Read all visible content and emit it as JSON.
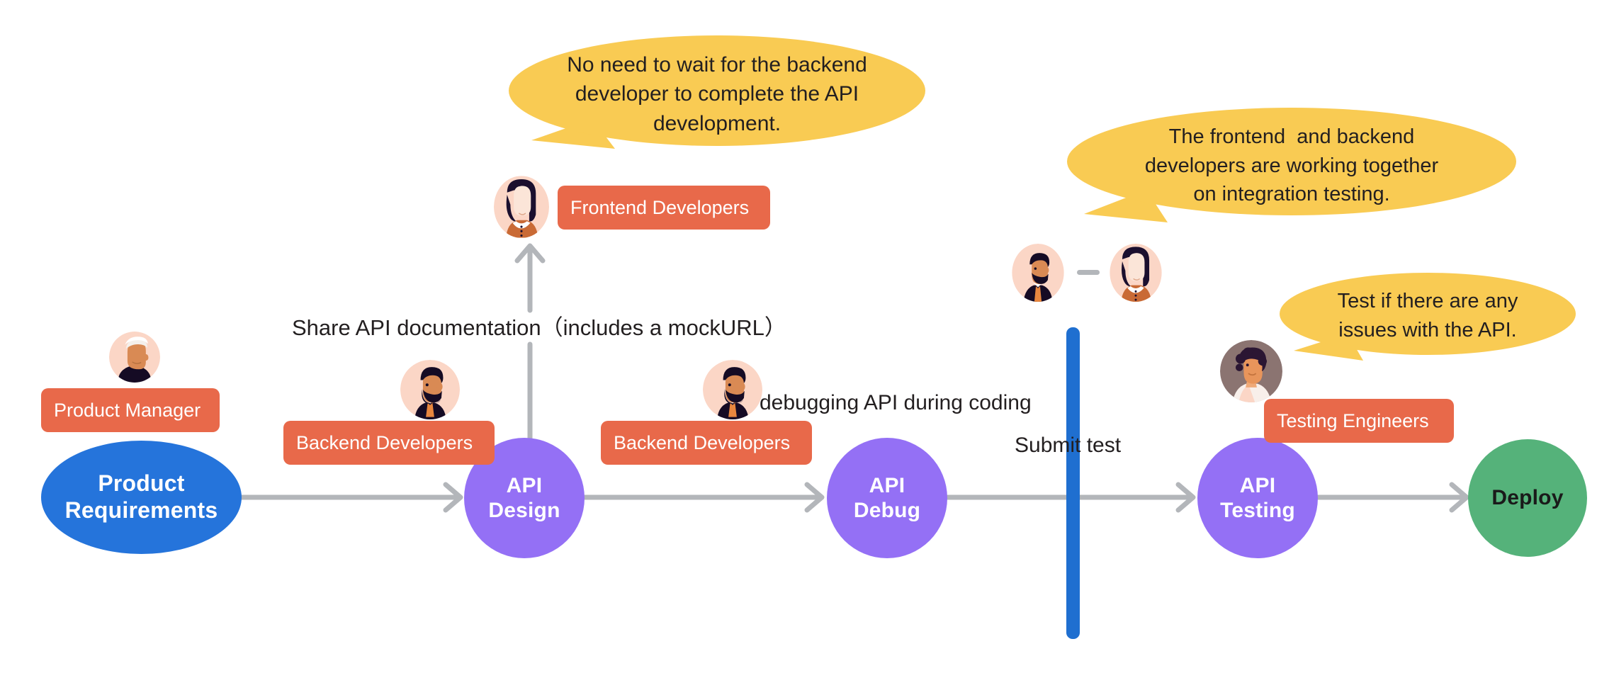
{
  "diagram": {
    "title": "API development collaboration flow",
    "colors": {
      "blue_node": "#2574DB",
      "purple_node": "#9470F5",
      "green_node": "#55B27A",
      "orange_pill": "#E8694A",
      "yellow_bubble": "#F9CB53",
      "arrow_grey": "#B3B6BA",
      "lane_blue": "#1F6FD0",
      "text_dark": "#231f20",
      "text_light": "#ffffff"
    },
    "flow_nodes": [
      {
        "id": "product-requirements",
        "label_line1": "Product",
        "label_line2": "Requirements",
        "shape": "ellipse",
        "fill": "#2574DB",
        "text_color": "#ffffff"
      },
      {
        "id": "api-design",
        "label_line1": "API",
        "label_line2": "Design",
        "shape": "circle",
        "fill": "#9470F5",
        "text_color": "#ffffff"
      },
      {
        "id": "api-debug",
        "label_line1": "API",
        "label_line2": "Debug",
        "shape": "circle",
        "fill": "#9470F5",
        "text_color": "#ffffff"
      },
      {
        "id": "api-testing",
        "label_line1": "API",
        "label_line2": "Testing",
        "shape": "circle",
        "fill": "#9470F5",
        "text_color": "#ffffff"
      },
      {
        "id": "deploy",
        "label_line1": "Deploy",
        "label_line2": "",
        "shape": "circle",
        "fill": "#55B27A",
        "text_color": "#1a1a1a"
      }
    ],
    "role_pills": [
      {
        "id": "product-manager",
        "label": "Product Manager"
      },
      {
        "id": "backend-developers-design",
        "label": "Backend Developers"
      },
      {
        "id": "frontend-developers",
        "label": "Frontend Developers"
      },
      {
        "id": "backend-developers-debug",
        "label": "Backend Developers"
      },
      {
        "id": "testing-engineers",
        "label": "Testing Engineers"
      }
    ],
    "annotations": [
      {
        "id": "share-api-documentation",
        "text": "Share API documentation（includes a mockURL）"
      },
      {
        "id": "debugging-api-during-coding",
        "text": "debugging API during coding"
      },
      {
        "id": "submit-test",
        "text": "Submit test"
      }
    ],
    "speech_bubbles": [
      {
        "id": "frontend-no-wait",
        "lines": [
          "No need to wait for the backend",
          "developer to complete the API",
          "development."
        ]
      },
      {
        "id": "integration-testing",
        "lines": [
          "The frontend  and backend",
          "developers are working together",
          "on integration testing."
        ]
      },
      {
        "id": "test-issues",
        "lines": [
          "Test if there are any",
          "issues with the API."
        ]
      }
    ]
  }
}
